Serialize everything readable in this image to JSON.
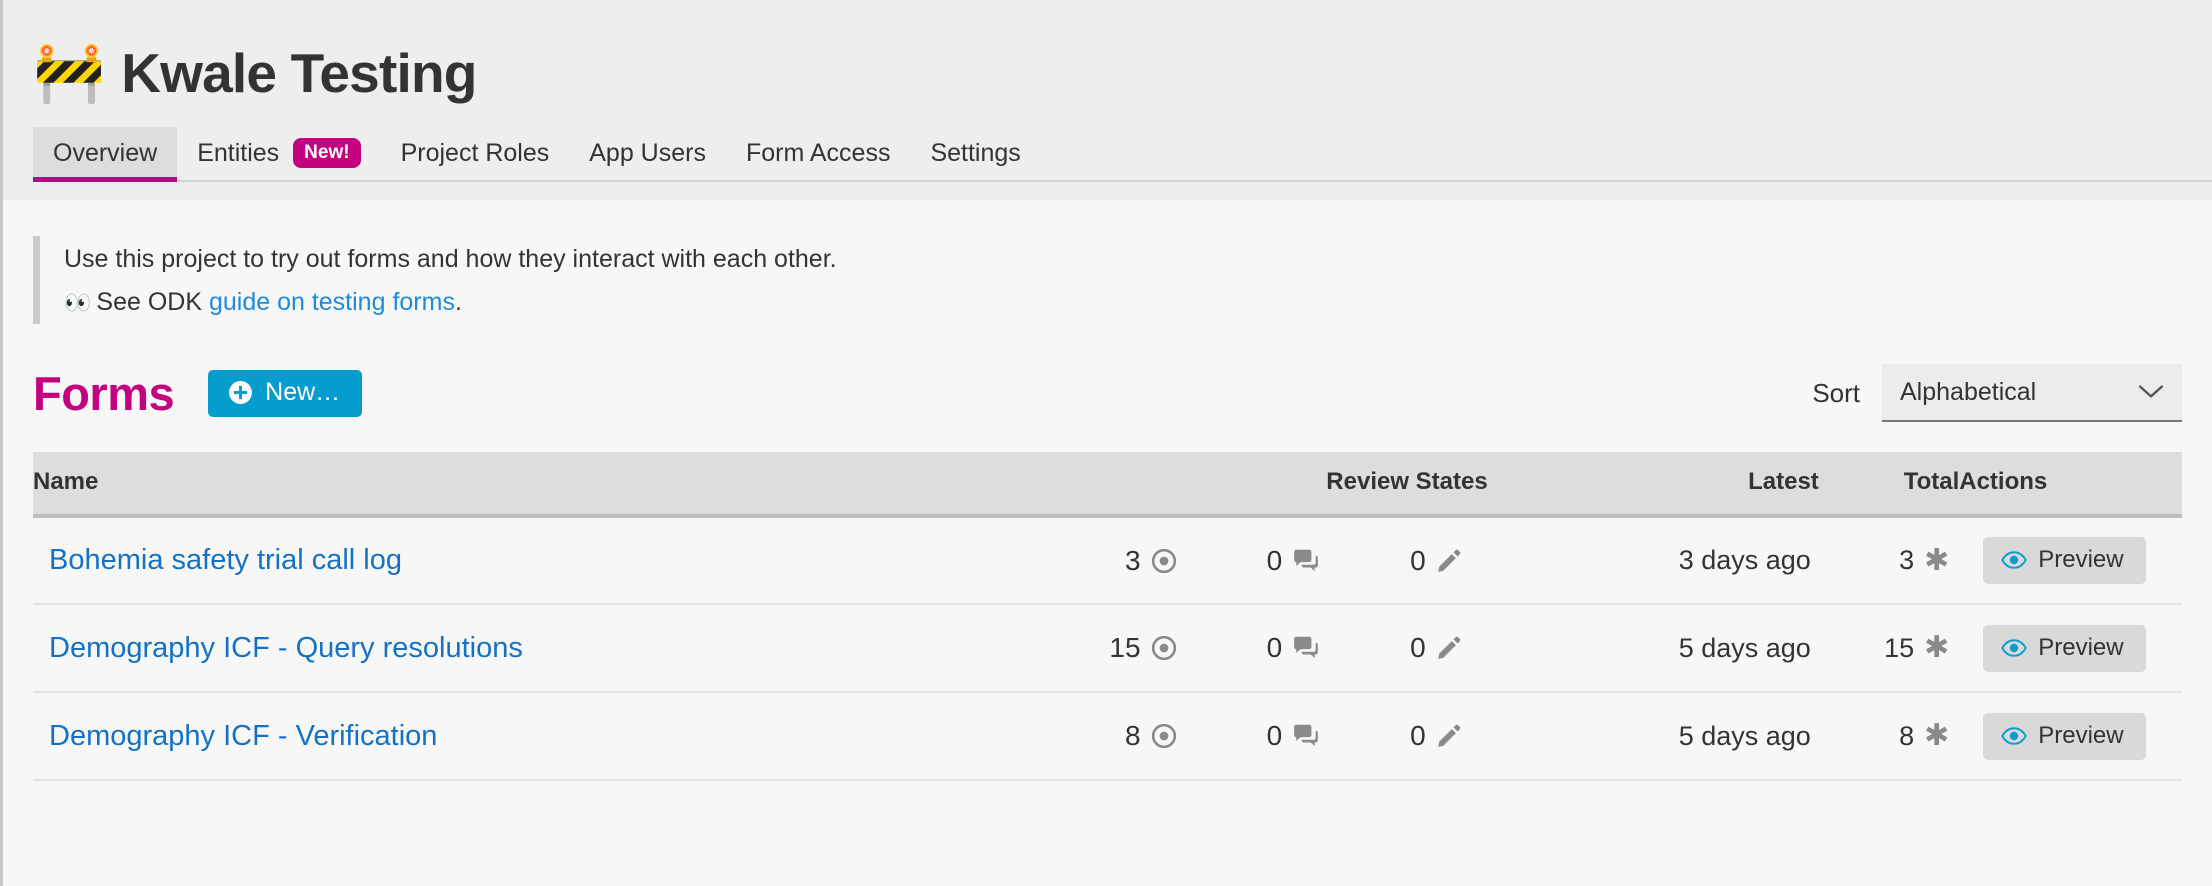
{
  "header": {
    "project_icon": "🚧",
    "project_icon_name": "construction-barrier-icon",
    "title": "Kwale Testing"
  },
  "nav": {
    "tabs": [
      {
        "label": "Overview",
        "active": true,
        "badge": null
      },
      {
        "label": "Entities",
        "active": false,
        "badge": "New!"
      },
      {
        "label": "Project Roles",
        "active": false,
        "badge": null
      },
      {
        "label": "App Users",
        "active": false,
        "badge": null
      },
      {
        "label": "Form Access",
        "active": false,
        "badge": null
      },
      {
        "label": "Settings",
        "active": false,
        "badge": null
      }
    ]
  },
  "info_banner": {
    "line1": "Use this project to try out forms and how they interact with each other.",
    "eyes_emoji": "👀",
    "line2_prefix": "See ODK ",
    "line2_link": "guide on testing forms",
    "line2_suffix": "."
  },
  "forms_section": {
    "heading": "Forms",
    "new_button_label": "New…",
    "sort_label": "Sort",
    "sort_value": "Alphabetical",
    "sort_options": [
      "Alphabetical"
    ]
  },
  "table": {
    "headers": {
      "name": "Name",
      "review_states": "Review States",
      "latest": "Latest",
      "total": "Total",
      "actions": "Actions"
    },
    "rows": [
      {
        "name": "Bohemia safety trial call log",
        "received": "3",
        "has_issues": "0",
        "edited": "0",
        "latest": "3 days ago",
        "total": "3",
        "action_label": "Preview"
      },
      {
        "name": "Demography ICF - Query resolutions",
        "received": "15",
        "has_issues": "0",
        "edited": "0",
        "latest": "5 days ago",
        "total": "15",
        "action_label": "Preview"
      },
      {
        "name": "Demography ICF - Verification",
        "received": "8",
        "has_issues": "0",
        "edited": "0",
        "latest": "5 days ago",
        "total": "8",
        "action_label": "Preview"
      }
    ]
  },
  "colors": {
    "brand_magenta": "#c4017f",
    "link_blue": "#1472c4",
    "action_blue": "#069ccd",
    "header_bg": "#eeeeee",
    "page_bg": "#f7f7f7"
  }
}
